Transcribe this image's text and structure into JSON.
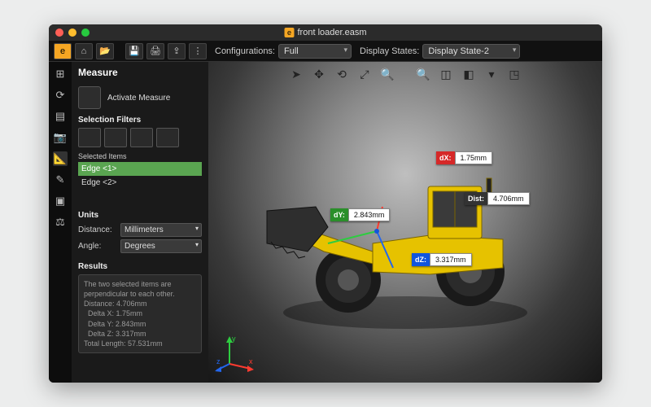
{
  "window": {
    "filename": "front loader.easm"
  },
  "toolbar": {
    "config_label": "Configurations:",
    "config_value": "Full",
    "display_label": "Display States:",
    "display_value": "Display State-2"
  },
  "panel": {
    "title": "Measure",
    "activate_label": "Activate Measure",
    "filters_label": "Selection Filters",
    "selected_label": "Selected Items",
    "items": [
      "Edge <1>",
      "Edge <2>"
    ],
    "units_label": "Units",
    "distance_label": "Distance:",
    "distance_unit": "Millimeters",
    "angle_label": "Angle:",
    "angle_unit": "Degrees",
    "results_label": "Results",
    "results_text": "The two selected items are perpendicular to each other.\nDistance: 4.706mm\n  Delta X: 1.75mm\n  Delta Y: 2.843mm\n  Delta Z: 3.317mm\nTotal Length: 57.531mm"
  },
  "callouts": {
    "dx": {
      "tag": "dX:",
      "value": "1.75mm",
      "color": "#d62828"
    },
    "dy": {
      "tag": "dY:",
      "value": "2.843mm",
      "color": "#2a8f2a"
    },
    "dz": {
      "tag": "dZ:",
      "value": "3.317mm",
      "color": "#1155dd"
    },
    "dist": {
      "tag": "Dist:",
      "value": "4.706mm",
      "color": "#333333"
    }
  },
  "axis": {
    "x": "x",
    "y": "y",
    "z": "z"
  }
}
